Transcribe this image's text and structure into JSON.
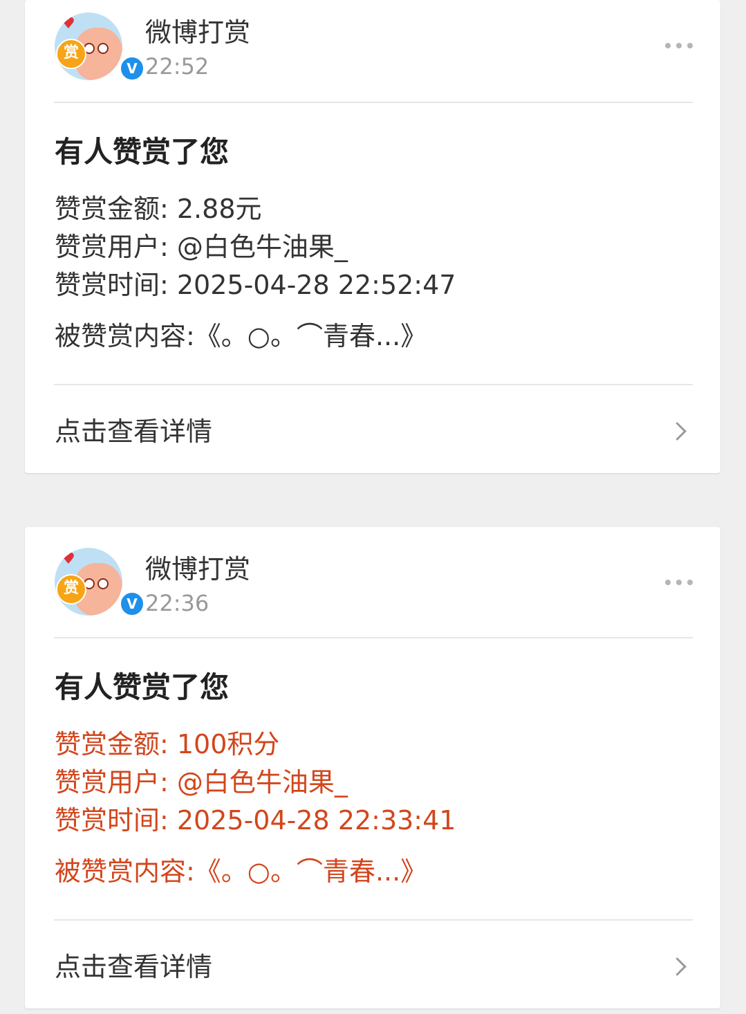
{
  "cards": [
    {
      "sender": "微博打赏",
      "time": "22:52",
      "title": "有人赞赏了您",
      "amount_line": "赞赏金额: 2.88元",
      "user_line": "赞赏用户: @白色牛油果_",
      "time_line": "赞赏时间: 2025-04-28 22:52:47",
      "content_line": "被赞赏内容:《。○。⌒青春...》",
      "details_label": "点击查看详情",
      "text_color": "#333333"
    },
    {
      "sender": "微博打赏",
      "time": "22:36",
      "title": "有人赞赏了您",
      "amount_line": "赞赏金额: 100积分",
      "user_line": "赞赏用户: @白色牛油果_",
      "time_line": "赞赏时间: 2025-04-28 22:33:41",
      "content_line": "被赞赏内容:《。○。⌒青春...》",
      "details_label": "点击查看详情",
      "text_color": "#d2461c"
    }
  ],
  "avatar": {
    "badge_text": "赏",
    "verified_text": "V"
  },
  "icons": [
    "more-dots-icon",
    "chevron-right-icon",
    "verified-badge-icon",
    "heart-icon"
  ],
  "colors": {
    "background": "#efefef",
    "card": "#ffffff",
    "highlight": "#d2461c",
    "verified": "#1e90ea"
  }
}
